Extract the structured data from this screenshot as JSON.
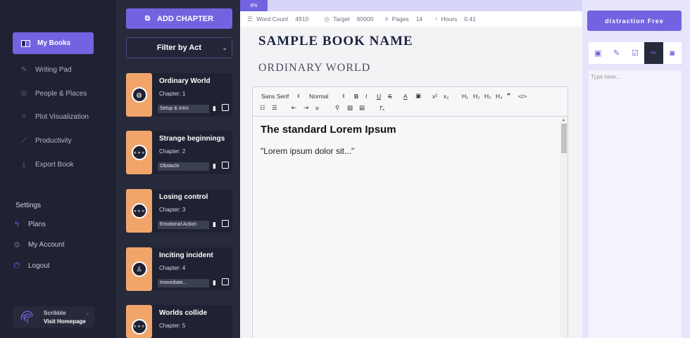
{
  "sidebar": {
    "active_item": "My Books",
    "items": [
      {
        "label": "Writing Pad",
        "icon": "pencil-icon"
      },
      {
        "label": "People & Places",
        "icon": "person-icon"
      },
      {
        "label": "Plot Visualization",
        "icon": "plot-icon"
      },
      {
        "label": "Productivity",
        "icon": "chart-icon"
      },
      {
        "label": "Export Book",
        "icon": "download-icon"
      }
    ],
    "settings_title": "Settings",
    "settings_items": [
      {
        "label": "Plans",
        "icon": "bolt-icon"
      },
      {
        "label": "My Account",
        "icon": "gear-icon"
      },
      {
        "label": "Logout",
        "icon": "power-icon"
      }
    ],
    "brand": {
      "name": "Scribble",
      "link": "Visit Homepage"
    }
  },
  "chapters": {
    "add_label": "ADD CHAPTER",
    "filter_label": "Filter by Act",
    "list": [
      {
        "title": "Ordinary World",
        "chapter": "Chapter: 1",
        "tag": "Setup & Intro",
        "icon": "globe-icon"
      },
      {
        "title": "Strange beginnings",
        "chapter": "Chapter: 2",
        "tag": "Obstacle",
        "icon": "dots-icon"
      },
      {
        "title": "Losing control",
        "chapter": "Chapter: 3",
        "tag": "Emotional Action",
        "icon": "dots-icon"
      },
      {
        "title": "Inciting incident",
        "chapter": "Chapter: 4",
        "tag": "Immediate...",
        "icon": "presenter-icon"
      },
      {
        "title": "Worlds collide",
        "chapter": "Chapter: 5",
        "tag": "",
        "icon": "dots-icon"
      }
    ]
  },
  "editor": {
    "progress_label": "8%",
    "progress": 0.08,
    "stats": {
      "word_count_label": "Word Count",
      "word_count": "4910",
      "target_label": "Target",
      "target": "60000",
      "pages_label": "Pages",
      "pages": "14",
      "hours_label": "Hours",
      "hours": "0.41"
    },
    "book_title": "SAMPLE BOOK NAME",
    "chapter_title": "ORDINARY WORLD",
    "toolbar": {
      "font": "Sans Serif",
      "size": "Normal"
    },
    "content_heading": "The standard Lorem Ipsum",
    "content_body": "\"Lorem ipsum dolor sit...\""
  },
  "right_panel": {
    "distraction_label": "distraction Free",
    "tools": [
      "book-icon",
      "edit-icon",
      "checklist-icon",
      "scissors-icon",
      "camera-icon"
    ],
    "active_tool": 3,
    "notes_placeholder": "Type here..."
  },
  "colors": {
    "accent": "#7264e0",
    "sidebar": "#1f2232",
    "chapter_bg": "#272a3b",
    "thumb": "#f2a56b"
  }
}
